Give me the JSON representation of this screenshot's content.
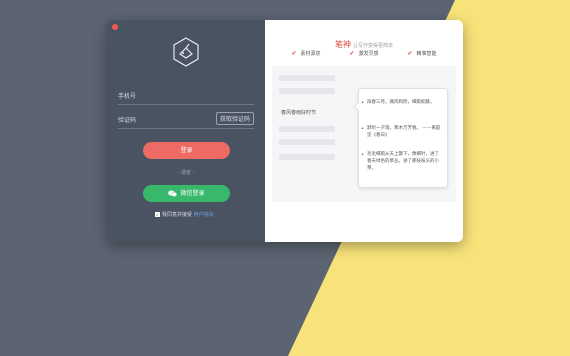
{
  "login": {
    "phone_label": "手机号",
    "code_label": "验证码",
    "get_code_label": "获取验证码",
    "login_label": "登录",
    "or_label": "- 或者 -",
    "wechat_label": "微信登录",
    "agree_label": "我同意并接受",
    "agreement_link": "用户协议"
  },
  "promo": {
    "brand": "笔神",
    "tagline": "让写作变得更简单",
    "features": [
      {
        "label": "素材源泉"
      },
      {
        "label": "激发灵感"
      },
      {
        "label": "精准智能"
      }
    ],
    "sample_line": "春风春雨好时节",
    "suggestions": [
      "阳春三月，微风和煦，细雨如酥。",
      "默听一夕雨，寒木万芳春。 ——黄庭坚《春日》",
      "毛毛细雨从天上飘下，像细针，进了春天绿色的草丛，进了那枝枝头的小芽。"
    ]
  },
  "colors": {
    "accent_red": "#ee6a64",
    "accent_green": "#37b86b",
    "left_panel": "#4a5362",
    "background": "#5c6472",
    "yellow": "#f8e37a"
  }
}
